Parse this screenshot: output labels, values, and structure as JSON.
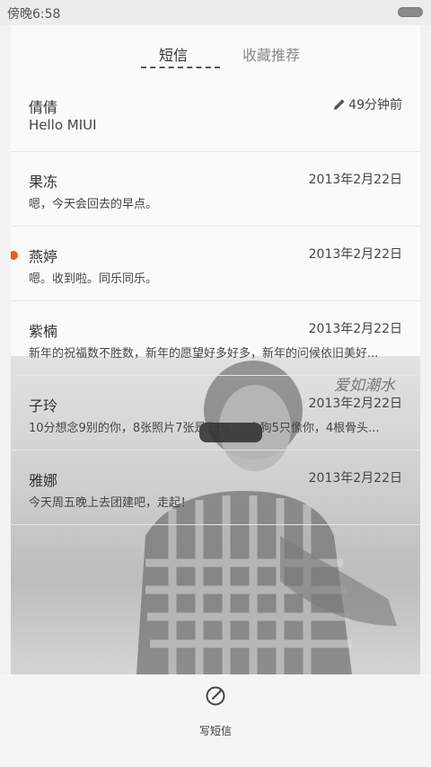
{
  "status_bar": {
    "time": "傍晚6:58"
  },
  "tabs": [
    {
      "label": "短信",
      "active": true
    },
    {
      "label": "收藏推荐",
      "active": false
    }
  ],
  "messages": [
    {
      "name": "倩倩",
      "date": "49分钟前",
      "preview": "Hello MIUI",
      "draft": true,
      "unread": false
    },
    {
      "name": "果冻",
      "date": "2013年2月22日",
      "preview": "嗯，今天会回去的早点。",
      "draft": false,
      "unread": false
    },
    {
      "name": "燕婷",
      "date": "2013年2月22日",
      "preview": "嗯。收到啦。同乐同乐。",
      "draft": false,
      "unread": true
    },
    {
      "name": "紫楠",
      "date": "2013年2月22日",
      "preview": "新年的祝福数不胜数，新年的愿望好多好多，新年的问候依旧美好...",
      "draft": false,
      "unread": false
    },
    {
      "name": "子玲",
      "date": "2013年2月22日",
      "preview": "10分想念9别的你，8张照片7张是你，6只小狗5只像你，4根骨头...",
      "draft": false,
      "unread": false
    },
    {
      "name": "雅娜",
      "date": "2013年2月22日",
      "preview": "今天周五晚上去团建吧，走起！",
      "draft": false,
      "unread": false
    }
  ],
  "background": {
    "watermark": "爱如潮水"
  },
  "bottom_bar": {
    "compose_label": "写短信"
  },
  "colors": {
    "unread_dot": "#f05a22",
    "background": "#f2f2f2"
  }
}
